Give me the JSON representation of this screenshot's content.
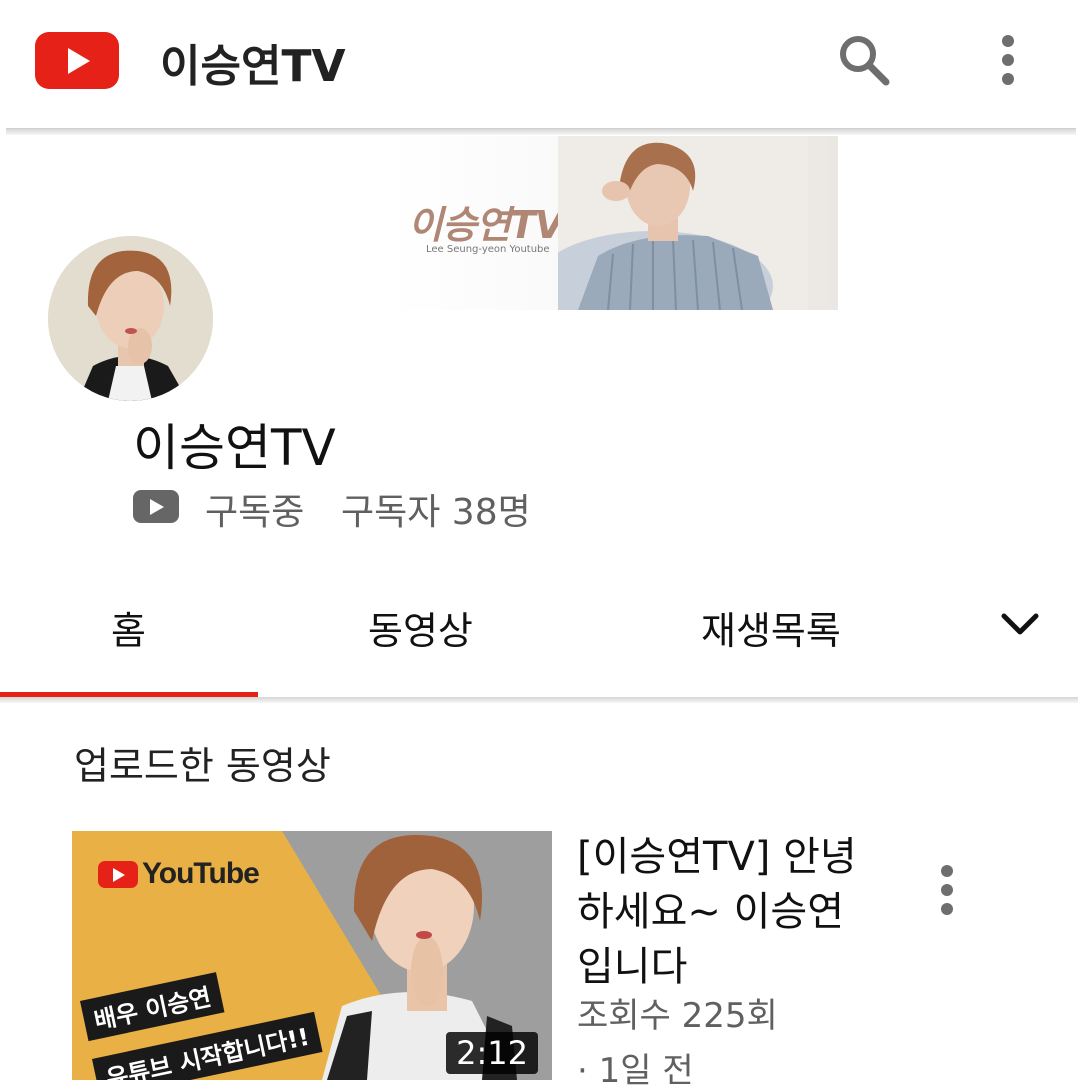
{
  "appbar": {
    "logo_icon": "youtube-logo-icon",
    "title": "이승연TV",
    "search_icon": "search-icon",
    "more_icon": "more-vert-icon"
  },
  "banner": {
    "title": "이승연TV",
    "subtitle": "Lee Seung-yeon Youtube"
  },
  "channel": {
    "name": "이승연TV",
    "subscription_status": "구독중",
    "subscriber_count": "구독자 38명"
  },
  "tabs": [
    {
      "label": "홈",
      "active": true
    },
    {
      "label": "동영상",
      "active": false
    },
    {
      "label": "재생목록",
      "active": false
    }
  ],
  "section": {
    "title": "업로드한 동영상"
  },
  "videos": [
    {
      "title": "[이승연TV] 안녕하세요~ 이승연입니다",
      "title_lines": [
        "[이승연TV] 안녕",
        "하세요~ 이승연",
        "입니다"
      ],
      "views": "조회수 225회",
      "age": "· 1일 전",
      "duration": "2:12",
      "thumbnail_logo_text": "YouTube",
      "thumbnail_caption_1": "배우 이승연",
      "thumbnail_caption_2": "유튜브 시작합니다!!"
    }
  ],
  "colors": {
    "brand_red": "#e62117",
    "thumbnail_yellow": "#e9b046",
    "secondary_text": "#606060"
  }
}
